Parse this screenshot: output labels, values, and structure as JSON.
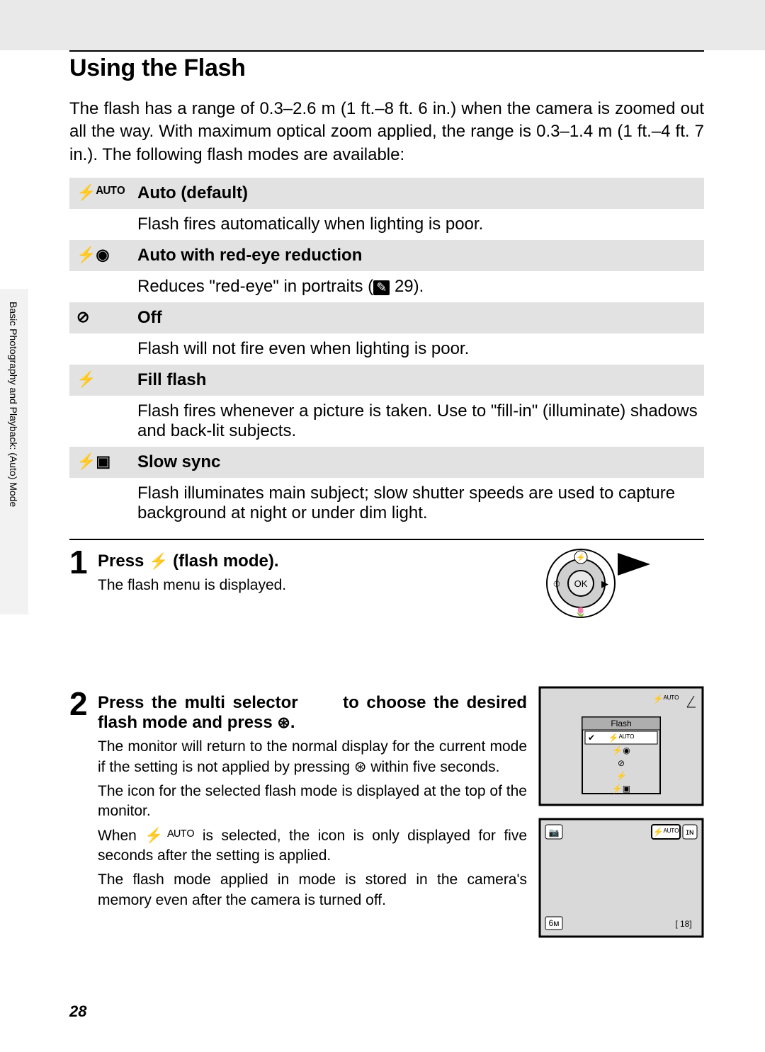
{
  "title": "Using the Flash",
  "intro": "The flash has a range of 0.3–2.6 m (1 ft.–8 ft. 6 in.) when the camera is zoomed out all the way. With maximum optical zoom applied, the range is 0.3–1.4 m (1 ft.–4 ft. 7 in.). The following flash modes are available:",
  "sidetab": "Basic Photography and Playback:    (Auto) Mode",
  "modes": [
    {
      "icon": "⚡ᴬᵁᵀᴼ",
      "name": "Auto (default)",
      "desc": "Flash fires automatically when lighting is poor."
    },
    {
      "icon": "⚡◉",
      "name": "Auto with red-eye reduction",
      "desc_pre": "Reduces \"red-eye\" in portraits (",
      "desc_ref": "29",
      "desc_post": ")."
    },
    {
      "icon": "⊘",
      "name": "Off",
      "desc": "Flash will not fire even when lighting is poor."
    },
    {
      "icon": "⚡",
      "name": "Fill flash",
      "desc": "Flash fires whenever a picture is taken. Use to \"fill-in\" (illuminate) shadows and back-lit subjects."
    },
    {
      "icon": "⚡▣",
      "name": "Slow sync",
      "desc": "Flash illuminates main subject; slow shutter speeds are used to capture background at night or under dim light."
    }
  ],
  "step1": {
    "num": "1",
    "title_pre": "Press ",
    "title_glyph": "⚡",
    "title_post": " (flash mode).",
    "body": "The flash menu is displayed."
  },
  "step2": {
    "num": "2",
    "title_line1_pre": "Press the multi selector ",
    "title_line1_post": " to choose the desired flash mode and press ",
    "title_glyph_ok": "⊛",
    "title_post": ".",
    "p1_pre": "The monitor will return to the normal display for the current mode if the setting is not applied by pressing ",
    "p1_ok": "⊛",
    "p1_post": " within five seconds.",
    "p2": "The icon for the selected flash mode is displayed at the top of the monitor.",
    "p3_pre": "When ",
    "p3_icon": "⚡ᴬᵁᵀᴼ",
    "p3_post": " is selected, the icon is only displayed for five seconds after the setting is applied.",
    "p4": "The flash mode applied in     mode is stored in the camera's memory even after the camera is turned off."
  },
  "screen1": {
    "top_icon": "⚡ᴬᵁᵀᴼ",
    "label": "Flash",
    "items": [
      "⚡ᴬᵁᵀᴼ",
      "⚡◉",
      "⊘",
      "⚡",
      "⚡▣"
    ]
  },
  "screen2": {
    "top_left": "📷",
    "top_mid": "⚡ᴬᵁᵀᴼ",
    "top_right": "ɪɴ",
    "bottom_left": "6ᴍ",
    "bottom_right": "[  18]"
  },
  "page": "28"
}
